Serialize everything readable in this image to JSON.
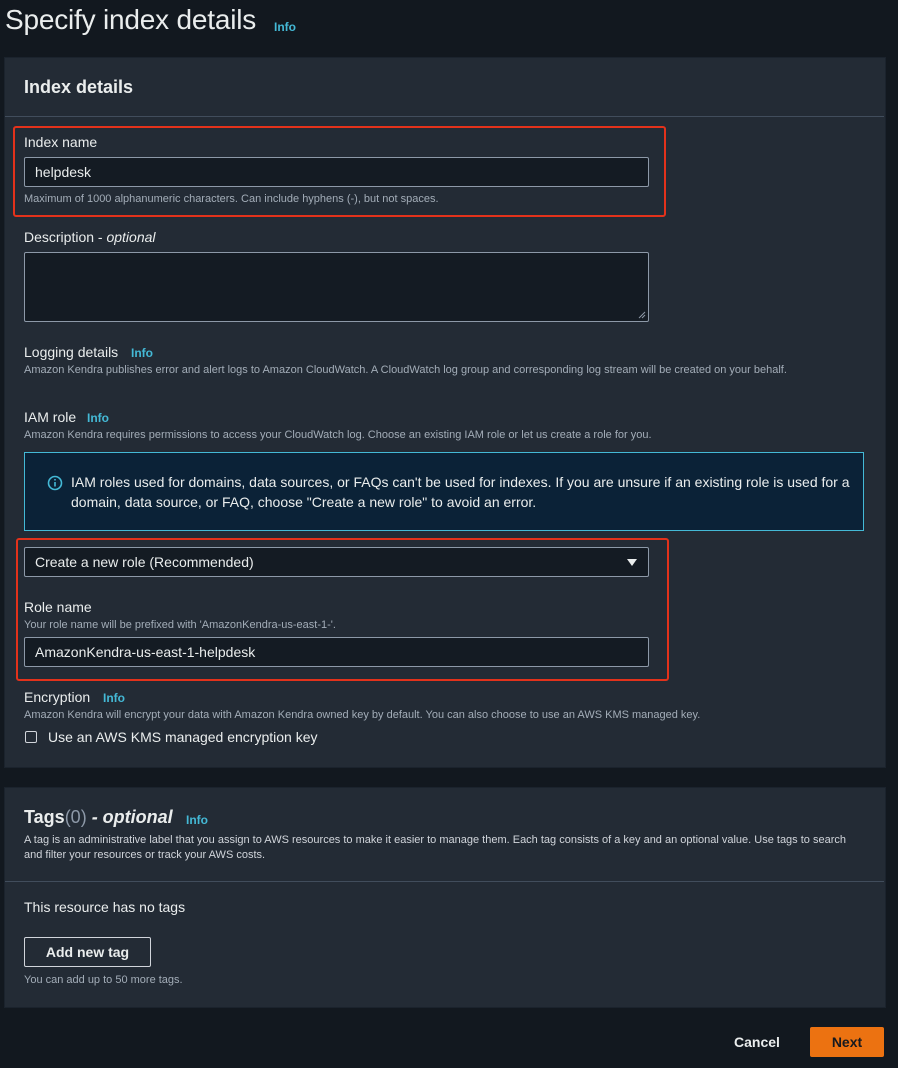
{
  "page": {
    "title": "Specify index details",
    "info": "Info"
  },
  "index_details": {
    "heading": "Index details",
    "index_name": {
      "label": "Index name",
      "value": "helpdesk",
      "hint": "Maximum of 1000 alphanumeric characters. Can include hyphens (-), but not spaces."
    },
    "description": {
      "label": "Description - ",
      "optional": "optional",
      "value": ""
    },
    "logging": {
      "label": "Logging details",
      "info": "Info",
      "desc": "Amazon Kendra publishes error and alert logs to Amazon CloudWatch. A CloudWatch log group and corresponding log stream will be created on your behalf."
    },
    "iam_role": {
      "label": "IAM role",
      "info": "Info",
      "desc": "Amazon Kendra requires permissions to access your CloudWatch log. Choose an existing IAM role or let us create a role for you.",
      "alert": "IAM roles used for domains, data sources, or FAQs can't be used for indexes. If you are unsure if an existing role is used for a domain, data source, or FAQ, choose \"Create a new role\" to avoid an error.",
      "selected": "Create a new role (Recommended)"
    },
    "role_name": {
      "label": "Role name",
      "hint": "Your role name will be prefixed with 'AmazonKendra-us-east-1-'.",
      "value": "AmazonKendra-us-east-1-helpdesk"
    },
    "encryption": {
      "label": "Encryption",
      "info": "Info",
      "desc": "Amazon Kendra will encrypt your data with Amazon Kendra owned key by default. You can also choose to use an AWS KMS managed key.",
      "checkbox_label": "Use an AWS KMS managed encryption key"
    }
  },
  "tags": {
    "heading": "Tags",
    "count": "(0)",
    "optional": " - optional",
    "info": "Info",
    "desc": "A tag is an administrative label that you assign to AWS resources to make it easier to manage them. Each tag consists of a key and an optional value. Use tags to search and filter your resources or track your AWS costs.",
    "empty": "This resource has no tags",
    "add_button": "Add new tag",
    "limit": "You can add up to 50 more tags."
  },
  "footer": {
    "cancel": "Cancel",
    "next": "Next"
  },
  "colors": {
    "accent": "#ec7211",
    "info": "#44b9d6",
    "highlight": "#e3321b"
  }
}
